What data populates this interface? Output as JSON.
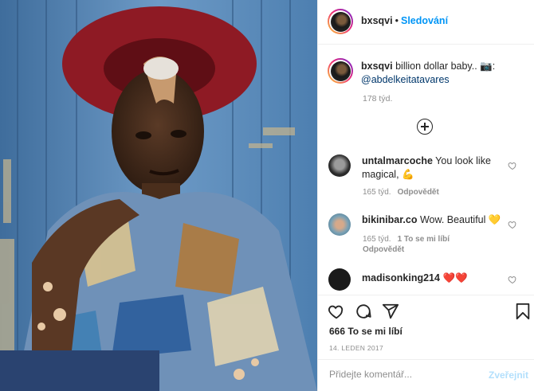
{
  "post": {
    "username": "bxsqvi",
    "separator": "•",
    "follow_label": "Sledování"
  },
  "caption": {
    "username": "bxsqvi",
    "text": "billion dollar baby.. 📷:",
    "mention": "@abdelkeitatavares",
    "time": "178 týd."
  },
  "comments": [
    {
      "username": "untalmarcoche",
      "text": "You look like magical, 💪",
      "time": "165 týd.",
      "reply_label": "Odpovědět",
      "likes": ""
    },
    {
      "username": "bikinibar.co",
      "text": "Wow. Beautiful 💛",
      "time": "165 týd.",
      "likes": "1 To se mi líbí",
      "reply_label": "Odpovědět"
    },
    {
      "username": "madisonking214",
      "text": "❤️❤️",
      "time": "",
      "reply_label": "",
      "likes": ""
    }
  ],
  "actions": {
    "like_icon": "heart-icon",
    "comment_icon": "comment-icon",
    "share_icon": "share-icon",
    "save_icon": "bookmark-icon",
    "likes": "666 To se mi líbí",
    "date": "14. LEDEN 2017"
  },
  "add_comment": {
    "placeholder": "Přidejte komentář...",
    "post_label": "Zveřejnit"
  },
  "colors": {
    "accent": "#0095f6",
    "muted": "#8e8e8e",
    "post_disabled": "#b2dffc"
  }
}
